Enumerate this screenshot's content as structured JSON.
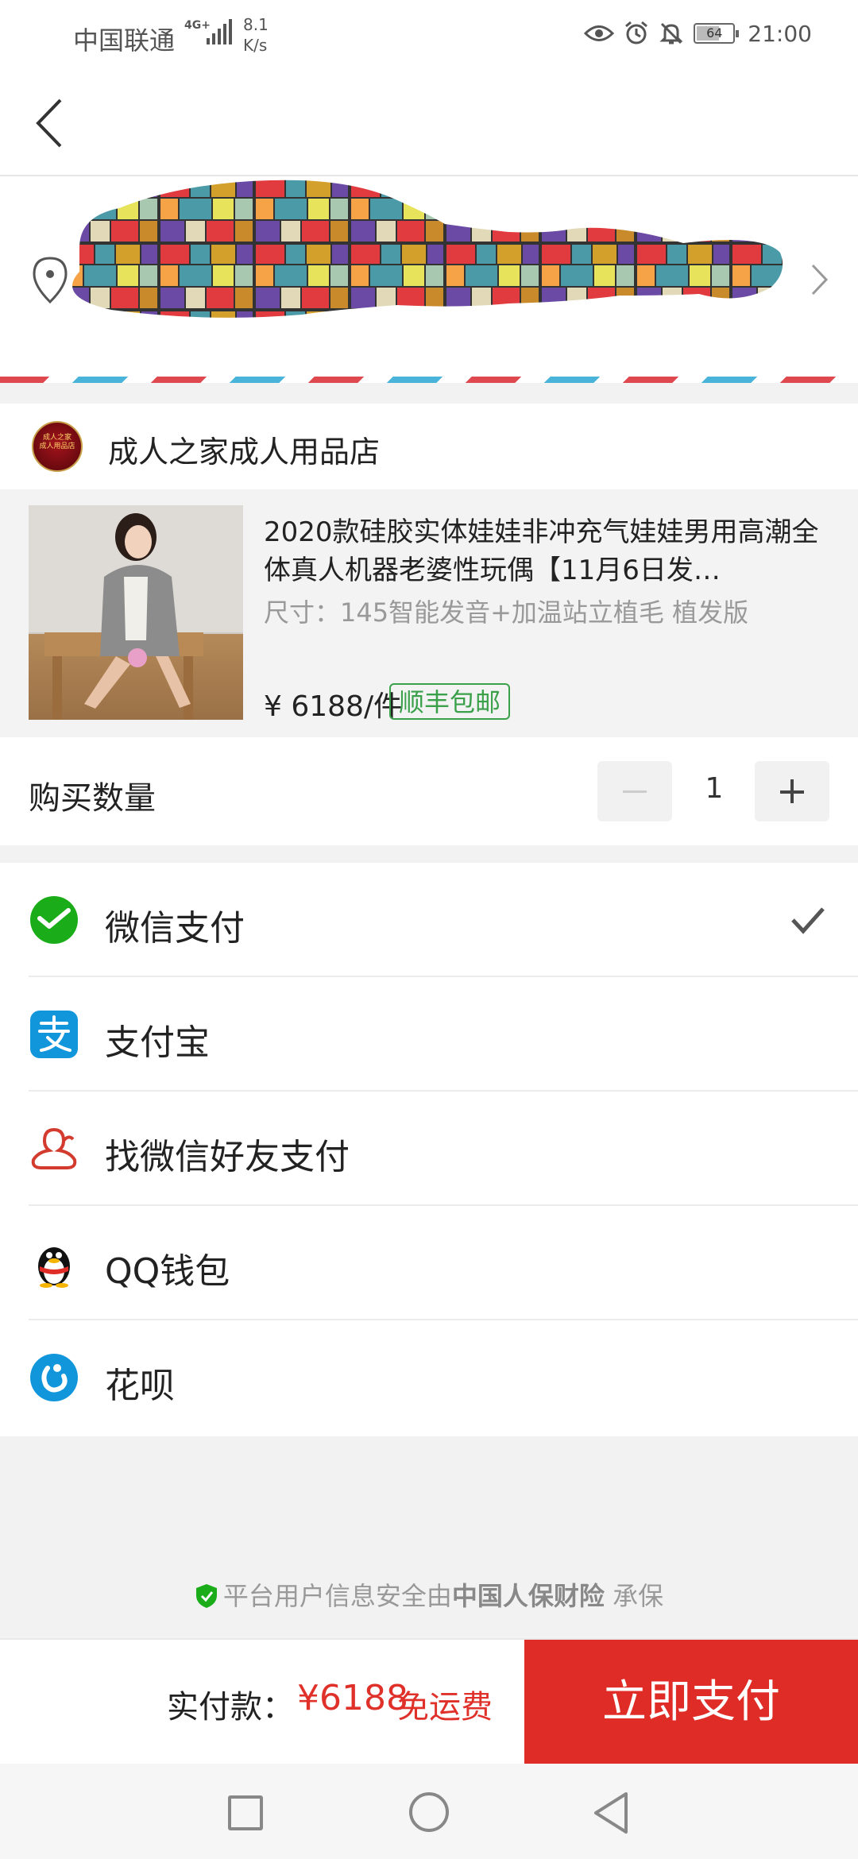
{
  "status_bar": {
    "carrier": "中国联通",
    "network": "4G+",
    "speed_value": "8.1",
    "speed_unit": "K/s",
    "battery": "64",
    "battery_level": 0.64,
    "time": "21:00"
  },
  "shop": {
    "logo_text_top": "成人之家",
    "logo_text_bottom": "成人用品店",
    "name": "成人之家成人用品店"
  },
  "product": {
    "title": "2020款硅胶实体娃娃非冲充气娃娃男用高潮全体真人机器老婆性玩偶【11月6日发…",
    "spec": "尺寸：145智能发音+加温站立植毛 植发版",
    "price": "¥ 6188/件",
    "shipping_tag": "顺丰包邮"
  },
  "quantity": {
    "label": "购买数量",
    "value": "1"
  },
  "payment_methods": [
    {
      "label": "微信支付",
      "icon": "wechat-pay-icon",
      "selected": true
    },
    {
      "label": "支付宝",
      "icon": "alipay-icon",
      "selected": false
    },
    {
      "label": "找微信好友支付",
      "icon": "friend-pay-icon",
      "selected": false
    },
    {
      "label": "QQ钱包",
      "icon": "qq-wallet-icon",
      "selected": false
    },
    {
      "label": "花呗",
      "icon": "huabei-icon",
      "selected": false
    }
  ],
  "security_note": {
    "prefix": "平台用户信息安全由",
    "insurer": "中国人保财险",
    "suffix": "承保"
  },
  "checkout": {
    "total_label": "实付款：",
    "total_amount": "¥6188",
    "free_shipping": "免运费",
    "pay_button": "立即支付"
  },
  "colors": {
    "accent_red": "#e02c27",
    "shipping_green": "#3aa14a",
    "wechat_green": "#1aad19",
    "alipay_blue": "#1296db"
  }
}
